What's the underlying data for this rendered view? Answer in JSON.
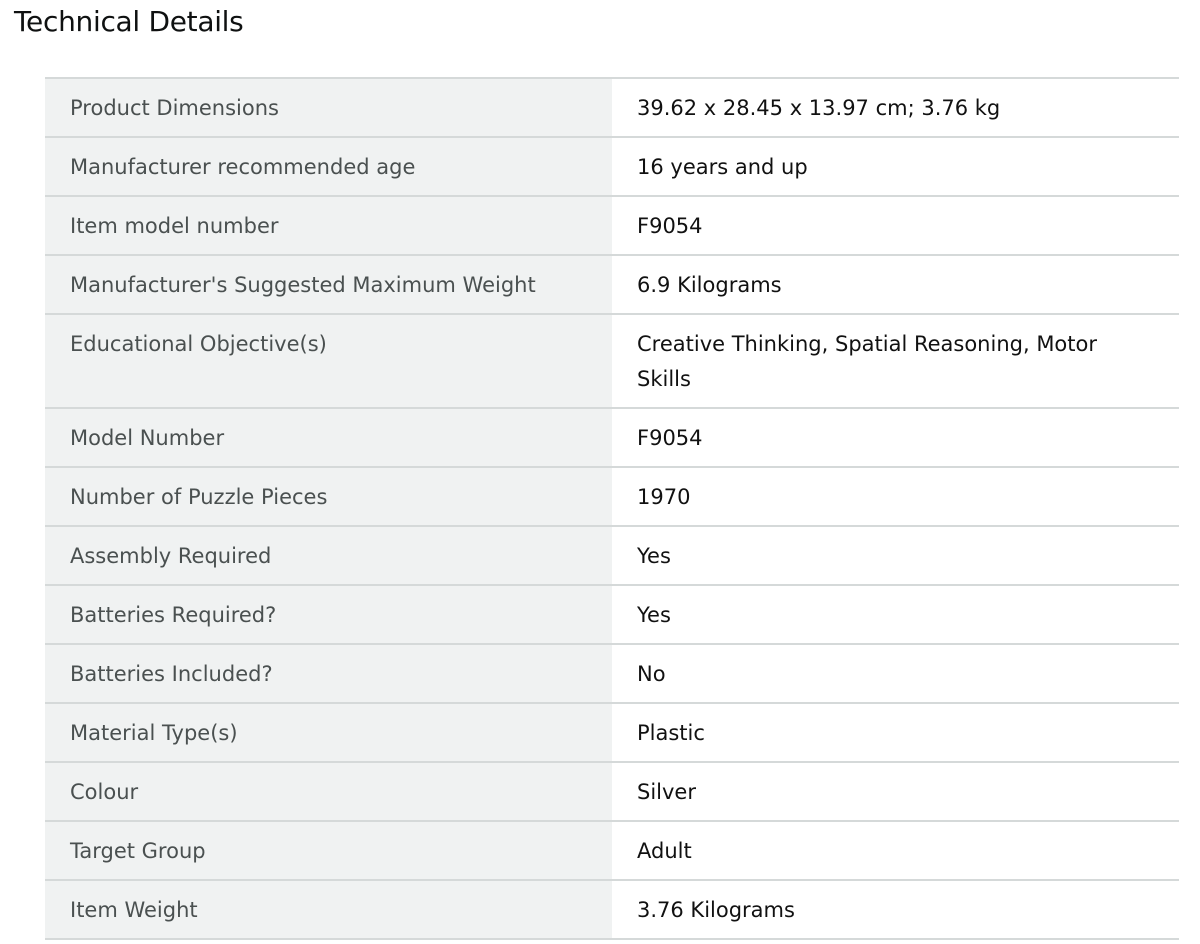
{
  "section": {
    "title": "Technical Details"
  },
  "rows": [
    {
      "label": "Product Dimensions",
      "value": "39.62 x 28.45 x 13.97 cm; 3.76 kg"
    },
    {
      "label": "Manufacturer recommended age",
      "value": "16 years and up"
    },
    {
      "label": "Item model number",
      "value": "F9054"
    },
    {
      "label": "Manufacturer's Suggested Maximum Weight",
      "value": "6.9 Kilograms"
    },
    {
      "label": "Educational Objective(s)",
      "value": "Creative Thinking, Spatial Reasoning, Motor Skills"
    },
    {
      "label": "Model Number",
      "value": "F9054"
    },
    {
      "label": "Number of Puzzle Pieces",
      "value": "1970"
    },
    {
      "label": "Assembly Required",
      "value": "Yes"
    },
    {
      "label": "Batteries Required?",
      "value": "Yes"
    },
    {
      "label": "Batteries Included?",
      "value": "No"
    },
    {
      "label": "Material Type(s)",
      "value": "Plastic"
    },
    {
      "label": "Colour",
      "value": "Silver"
    },
    {
      "label": "Target Group",
      "value": "Adult"
    },
    {
      "label": "Item Weight",
      "value": "3.76 Kilograms"
    }
  ]
}
